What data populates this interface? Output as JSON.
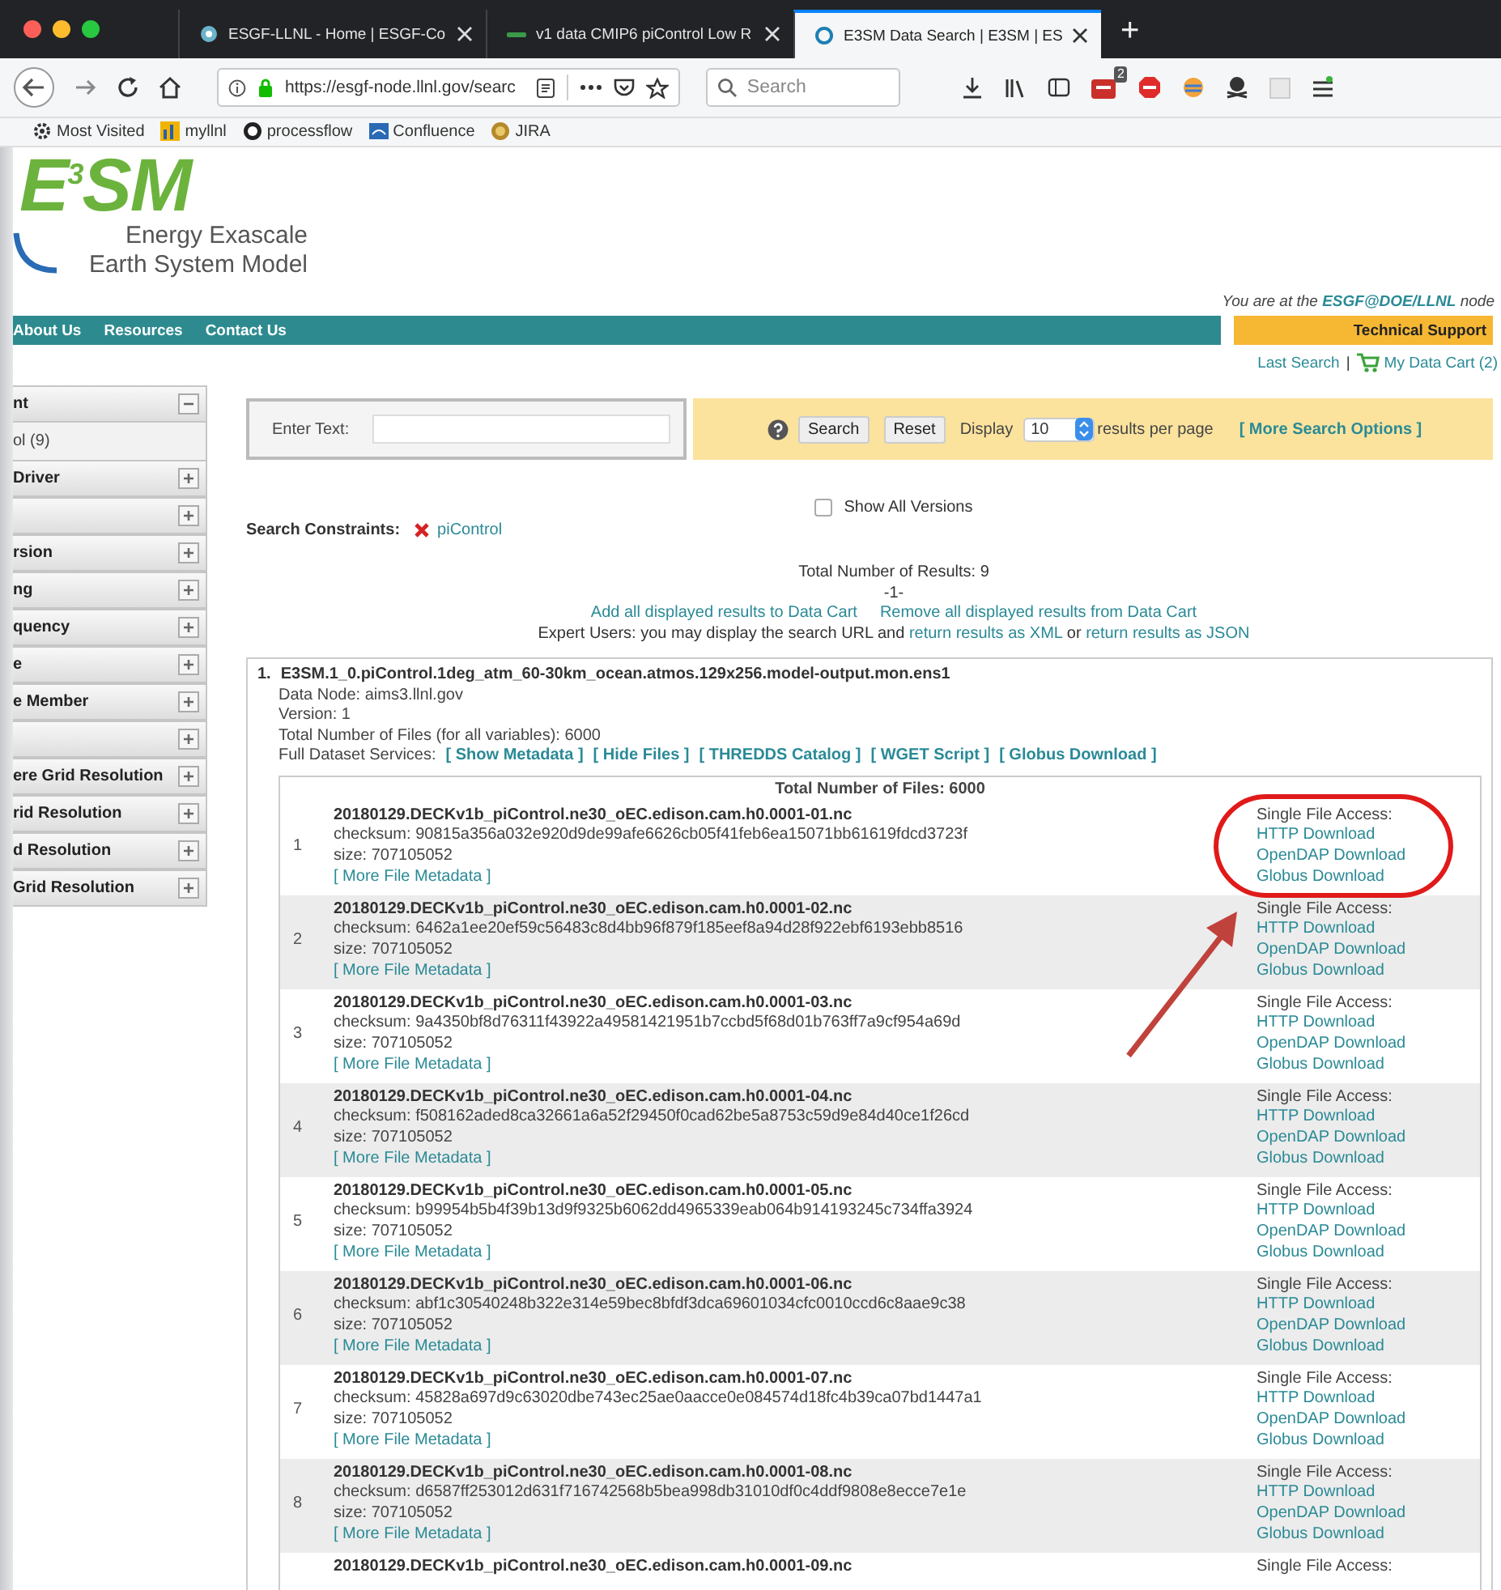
{
  "browser": {
    "tabs": [
      {
        "title": "ESGF-LLNL - Home | ESGF-Co",
        "selected": false,
        "kind": "gear"
      },
      {
        "title": "v1 data CMIP6 piControl Low R",
        "selected": false,
        "kind": "bar"
      },
      {
        "title": "E3SM Data Search | E3SM | ES",
        "selected": true,
        "kind": "ring"
      }
    ],
    "new_tab": "+",
    "url": "https://esgf-node.llnl.gov/searc",
    "search_placeholder": "Search",
    "extension_badge": "2",
    "bookmarks": [
      {
        "label": "Most Visited",
        "kind": "gear"
      },
      {
        "label": "myllnl",
        "kind": "chart"
      },
      {
        "label": "processflow",
        "kind": "cat"
      },
      {
        "label": "Confluence",
        "kind": "doc"
      },
      {
        "label": "JIRA",
        "kind": "globe"
      }
    ]
  },
  "header": {
    "logo": "E$^{3}$SM",
    "logo_lines": [
      "Energy Exascale",
      "Earth System Model"
    ],
    "node_notice": "You are at the **ESGF@DOE/LLNL** node",
    "nav": [
      "About Us",
      "Resources",
      "Contact Us"
    ],
    "support": "Technical Support",
    "last_search": "Last Search",
    "separator": "|",
    "cart": "My Data Cart (2)"
  },
  "sidebar": [
    {
      "label": "nt",
      "expanded": true,
      "children": [
        {
          "label": "ol (9)"
        }
      ]
    },
    {
      "label": "Driver",
      "expanded": false
    },
    {
      "expanded": false
    },
    {
      "label": "rsion",
      "expanded": false
    },
    {
      "label": "ng",
      "expanded": false
    },
    {
      "label": "quency",
      "expanded": false
    },
    {
      "label": "e",
      "expanded": false
    },
    {
      "label": "e Member",
      "expanded": false
    },
    {
      "expanded": false
    },
    {
      "label": "ere Grid Resolution",
      "expanded": false
    },
    {
      "label": "rid Resolution",
      "expanded": false
    },
    {
      "label": "d Resolution",
      "expanded": false
    },
    {
      "label": "Grid Resolution",
      "expanded": false
    }
  ],
  "search": {
    "label": "Enter Text:",
    "buttons": [
      "Search",
      "Reset"
    ],
    "display_label": "Display",
    "per_page": "10",
    "per_page_suffix": "results per page",
    "more_options": "[ More Search Options ]",
    "show_all_versions": {
      "label": "Show All Versions",
      "checked": false
    },
    "constraints_label": "Search Constraints:",
    "constraints": [
      "piControl"
    ]
  },
  "results": {
    "total": "Total Number of Results: 9",
    "page": "-1-",
    "cart_links": [
      "Add all displayed results to Data Cart",
      "Remove all displayed results from Data Cart"
    ],
    "expert": [
      "Expert Users: you may display the search URL and ",
      "return results as XML",
      " or ",
      "return results as JSON"
    ]
  },
  "dataset": {
    "index": "1.",
    "title": "E3SM.1_0.piControl.1deg_atm_60-30km_ocean.atmos.129x256.model-output.mon.ens1",
    "details": [
      "Data Node: aims3.llnl.gov",
      "Version: 1",
      "Total Number of Files (for all variables): 6000"
    ],
    "services_label": "Full Dataset Services:",
    "services": [
      "[ Show Metadata ]",
      "[ Hide Files ]",
      "[ THREDDS Catalog ]",
      "[ WGET Script ]",
      "[ Globus Download ]"
    ],
    "files_total": "Total Number of Files: 6000",
    "files": [
      {
        "number": "1",
        "name": "20180129.DECKv1b_piControl.ne30_oEC.edison.cam.h0.0001-01.nc",
        "checksum": "checksum: 90815a356a032e920d9de99afe6626cb05f41feb6ea15071bb61619fdcd3723f",
        "size": "size: 707105052",
        "metadata": "[ More File Metadata ]",
        "access_label": "Single File Access:",
        "links": [
          "HTTP Download",
          "OpenDAP Download",
          "Globus Download"
        ]
      },
      {
        "number": "2",
        "name": "20180129.DECKv1b_piControl.ne30_oEC.edison.cam.h0.0001-02.nc",
        "checksum": "checksum: 6462a1ee20ef59c56483c8d4bb96f879f185eef8a94d28f922ebf6193ebb8516",
        "size": "size: 707105052",
        "metadata": "[ More File Metadata ]",
        "access_label": "Single File Access:",
        "links": [
          "HTTP Download",
          "OpenDAP Download",
          "Globus Download"
        ]
      },
      {
        "number": "3",
        "name": "20180129.DECKv1b_piControl.ne30_oEC.edison.cam.h0.0001-03.nc",
        "checksum": "checksum: 9a4350bf8d76311f43922a49581421951b7ccbd5f68d01b763ff7a9cf954a69d",
        "size": "size: 707105052",
        "metadata": "[ More File Metadata ]",
        "access_label": "Single File Access:",
        "links": [
          "HTTP Download",
          "OpenDAP Download",
          "Globus Download"
        ]
      },
      {
        "number": "4",
        "name": "20180129.DECKv1b_piControl.ne30_oEC.edison.cam.h0.0001-04.nc",
        "checksum": "checksum: f508162aded8ca32661a6a52f29450f0cad62be5a8753c59d9e84d40ce1f26cd",
        "size": "size: 707105052",
        "metadata": "[ More File Metadata ]",
        "access_label": "Single File Access:",
        "links": [
          "HTTP Download",
          "OpenDAP Download",
          "Globus Download"
        ]
      },
      {
        "number": "5",
        "name": "20180129.DECKv1b_piControl.ne30_oEC.edison.cam.h0.0001-05.nc",
        "checksum": "checksum: b99954b5b4f39b13d9f9325b6062dd4965339eab064b914193245c734ffa3924",
        "size": "size: 707105052",
        "metadata": "[ More File Metadata ]",
        "access_label": "Single File Access:",
        "links": [
          "HTTP Download",
          "OpenDAP Download",
          "Globus Download"
        ]
      },
      {
        "number": "6",
        "name": "20180129.DECKv1b_piControl.ne30_oEC.edison.cam.h0.0001-06.nc",
        "checksum": "checksum: abf1c30540248b322e314e59bec8bfdf3dca69601034cfc0010ccd6c8aae9c38",
        "size": "size: 707105052",
        "metadata": "[ More File Metadata ]",
        "access_label": "Single File Access:",
        "links": [
          "HTTP Download",
          "OpenDAP Download",
          "Globus Download"
        ]
      },
      {
        "number": "7",
        "name": "20180129.DECKv1b_piControl.ne30_oEC.edison.cam.h0.0001-07.nc",
        "checksum": "checksum: 45828a697d9c63020dbe743ec25ae0aacce0e084574d18fc4b39ca07bd1447a1",
        "size": "size: 707105052",
        "metadata": "[ More File Metadata ]",
        "access_label": "Single File Access:",
        "links": [
          "HTTP Download",
          "OpenDAP Download",
          "Globus Download"
        ]
      },
      {
        "number": "8",
        "name": "20180129.DECKv1b_piControl.ne30_oEC.edison.cam.h0.0001-08.nc",
        "checksum": "checksum: d6587ff253012d631f716742568b5bea998db31010df0c4ddf9808e8ecce7e1e",
        "size": "size: 707105052",
        "metadata": "[ More File Metadata ]",
        "access_label": "Single File Access:",
        "links": [
          "HTTP Download",
          "OpenDAP Download",
          "Globus Download"
        ]
      },
      {
        "name": "20180129.DECKv1b_piControl.ne30_oEC.edison.cam.h0.0001-09.nc",
        "access_label": "Single File Access:"
      }
    ]
  }
}
